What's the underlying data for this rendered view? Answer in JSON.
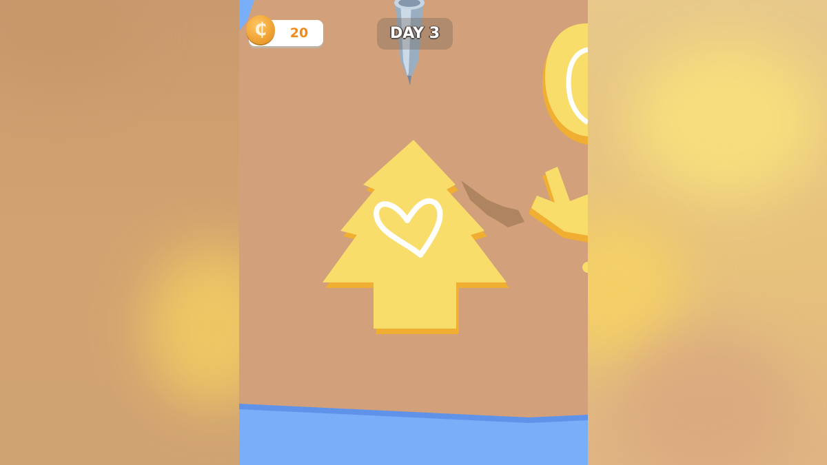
{
  "hud": {
    "coins": "20",
    "coin_icon": "coin-icon",
    "coin_symbol": "₵",
    "day_label": "DAY 3"
  },
  "scene": {
    "main_cookie": "tree-cookie",
    "main_decoration": "heart-icing",
    "side_cookies": [
      "round-cookie",
      "antler-cookie"
    ],
    "tool": "icing-piping-bag",
    "colors": {
      "board": "#d2a07a",
      "cookie": "#f9dd6b",
      "cookie_edge": "#f2b32e",
      "icing": "#ffffff",
      "water": "#79aef8",
      "coin": "#f0a233"
    }
  }
}
